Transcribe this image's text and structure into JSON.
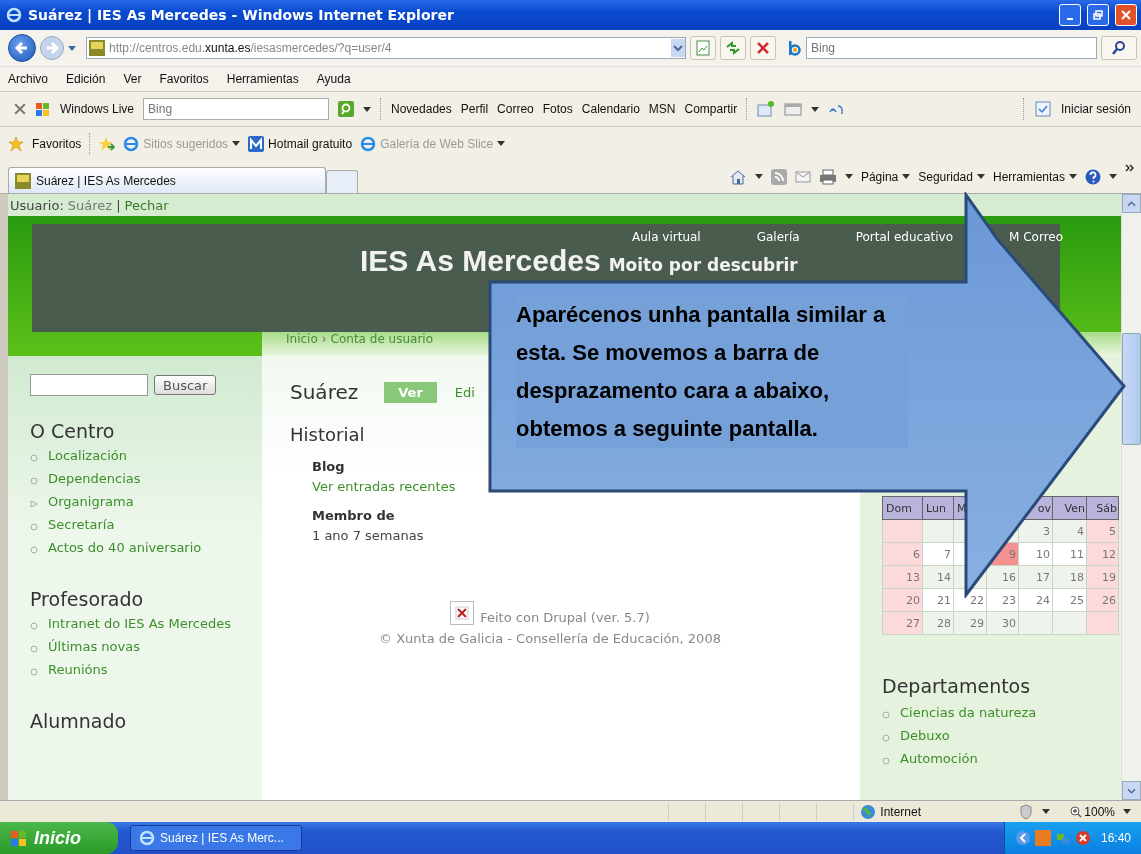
{
  "window": {
    "title": "Suárez | IES As Mercedes - Windows Internet Explorer"
  },
  "address_bar": {
    "url_prefix": "http://centros.edu.",
    "url_domain": "xunta.es",
    "url_suffix": "/iesasmercedes/?q=user/4"
  },
  "search_box": {
    "placeholder": "Bing"
  },
  "menu_bar": [
    "Archivo",
    "Edición",
    "Ver",
    "Favoritos",
    "Herramientas",
    "Ayuda"
  ],
  "live_toolbar": {
    "brand": "Windows Live",
    "search_placeholder": "Bing",
    "links": [
      "Novedades",
      "Perfil",
      "Correo",
      "Fotos",
      "Calendario",
      "MSN",
      "Compartir"
    ],
    "sign_in": "Iniciar sesión"
  },
  "favorites_bar": {
    "label": "Favoritos",
    "items": [
      {
        "label": "Sitios sugeridos",
        "dropdown": true
      },
      {
        "label": "Hotmail gratuito",
        "dropdown": false
      },
      {
        "label": "Galería de Web Slice",
        "dropdown": true
      }
    ]
  },
  "tabs": [
    {
      "label": "Suárez | IES As Mercedes",
      "selected": true
    }
  ],
  "command_bar": [
    "Página",
    "Seguridad",
    "Herramientas"
  ],
  "page": {
    "user_bar": {
      "label": "Usuario:",
      "user": "Suárez",
      "separator": "|",
      "logout": "Pechar"
    },
    "top_nav": [
      "Aula virtual",
      "Galería",
      "Portal educativo",
      "M Correo"
    ],
    "site_title": "IES As Mercedes",
    "slogan": "Moito por descubrir",
    "breadcrumb": [
      "Inicio",
      "Conta de usuario"
    ],
    "breadcrumb_separator": "›",
    "sidebar": {
      "search_button": "Buscar",
      "sections": [
        {
          "title": "O Centro",
          "items": [
            {
              "label": "Localización",
              "kind": "bullet"
            },
            {
              "label": "Dependencias",
              "kind": "bullet"
            },
            {
              "label": "Organigrama",
              "kind": "arrow"
            },
            {
              "label": "Secretaría",
              "kind": "bullet"
            },
            {
              "label": "Actos do 40 aniversario",
              "kind": "bullet"
            }
          ]
        },
        {
          "title": "Profesorado",
          "items": [
            {
              "label": "Intranet do IES As Mercedes",
              "kind": "bullet"
            },
            {
              "label": "Últimas novas",
              "kind": "bullet"
            },
            {
              "label": "Reunións",
              "kind": "bullet"
            }
          ]
        },
        {
          "title": "Alumnado"
        }
      ]
    },
    "content": {
      "title": "Suárez",
      "tabs": [
        {
          "label": "Ver",
          "selected": true
        },
        {
          "label": "Edi",
          "selected": false
        }
      ],
      "section": "Historial",
      "fields": [
        {
          "label": "Blog",
          "value": "Ver entradas recentes",
          "link": true
        },
        {
          "label": "Membro de",
          "value": "1 ano 7 semanas",
          "link": false
        }
      ],
      "powered_by": "Feito con Drupal (ver. 5.7)",
      "copyright": "© Xunta de Galicia - Consellería de Educación, 2008"
    },
    "calendar": {
      "headers": [
        {
          "kind": "label",
          "text": "Dom"
        },
        {
          "kind": "label",
          "text": "Lun"
        },
        {
          "kind": "label",
          "text": "M"
        },
        {
          "kind": "blank"
        },
        {
          "kind": "label",
          "text": "ov"
        },
        {
          "kind": "label",
          "text": "Ven"
        },
        {
          "kind": "label",
          "text": "Sáb"
        }
      ],
      "weeks": [
        [
          {
            "kind": "blank"
          },
          {
            "kind": "blank"
          },
          {
            "kind": "blank"
          },
          {
            "kind": "blank"
          },
          {
            "kind": "day",
            "d": "3",
            "today": false
          },
          {
            "kind": "day",
            "d": "4",
            "today": false
          },
          {
            "kind": "day",
            "d": "5",
            "today": false
          }
        ],
        [
          {
            "kind": "day",
            "d": "6",
            "today": false
          },
          {
            "kind": "day",
            "d": "7",
            "today": false
          },
          {
            "kind": "blank"
          },
          {
            "kind": "day",
            "d": "9",
            "today": true
          },
          {
            "kind": "day",
            "d": "10",
            "today": false
          },
          {
            "kind": "day",
            "d": "11",
            "today": false
          },
          {
            "kind": "day",
            "d": "12",
            "today": false
          }
        ],
        [
          {
            "kind": "day",
            "d": "13",
            "today": false
          },
          {
            "kind": "day",
            "d": "14",
            "today": false
          },
          {
            "kind": "blank"
          },
          {
            "kind": "day",
            "d": "16",
            "today": false
          },
          {
            "kind": "day",
            "d": "17",
            "today": false
          },
          {
            "kind": "day",
            "d": "18",
            "today": false
          },
          {
            "kind": "day",
            "d": "19",
            "today": false
          }
        ],
        [
          {
            "kind": "day",
            "d": "20",
            "today": false
          },
          {
            "kind": "day",
            "d": "21",
            "today": false
          },
          {
            "kind": "day",
            "d": "22",
            "today": false
          },
          {
            "kind": "day",
            "d": "23",
            "today": false
          },
          {
            "kind": "day",
            "d": "24",
            "today": false
          },
          {
            "kind": "day",
            "d": "25",
            "today": false
          },
          {
            "kind": "day",
            "d": "26",
            "today": false
          }
        ],
        [
          {
            "kind": "day",
            "d": "27",
            "today": false
          },
          {
            "kind": "day",
            "d": "28",
            "today": false
          },
          {
            "kind": "day",
            "d": "29",
            "today": false
          },
          {
            "kind": "day",
            "d": "30",
            "today": false
          },
          {
            "kind": "blank"
          },
          {
            "kind": "blank"
          },
          {
            "kind": "blank"
          }
        ]
      ]
    },
    "departments": {
      "title": "Departamentos",
      "items": [
        "Ciencias da natureza",
        "Debuxo",
        "Automoción"
      ]
    }
  },
  "callout": {
    "text": "Aparécenos unha pantalla similar a esta. Se movemos a barra de desprazamento cara a abaixo, obtemos a seguinte pantalla."
  },
  "status_bar": {
    "zone": "Internet",
    "zoom": "100%"
  },
  "taskbar": {
    "start": "Inicio",
    "tasks": [
      "Suárez | IES As Merc..."
    ],
    "clock": "16:40"
  }
}
